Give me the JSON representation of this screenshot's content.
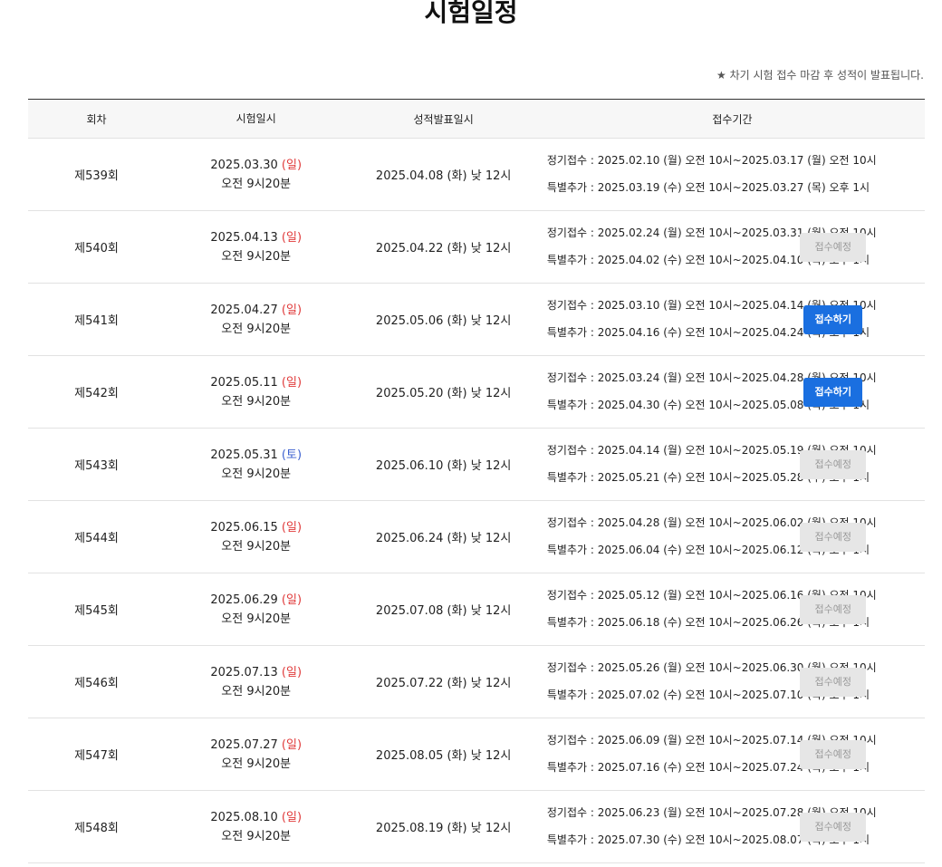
{
  "page": {
    "title": "시험일정",
    "notice": "★ 차기 시험 접수 마감 후 성적이 발표됩니다."
  },
  "table": {
    "headers": [
      "회차",
      "시험일시",
      "성적발표일시",
      "접수기간"
    ],
    "rows": [
      {
        "round": "제539회",
        "exam_date": "2025.03.30",
        "exam_dow": "(일)",
        "exam_dow_type": "sun",
        "exam_time": "오전 9시20분",
        "result_date": "2025.04.08 (화) 낮 12시",
        "regular": "정기접수 : 2025.02.10 (월) 오전 10시~2025.03.17 (월) 오전 10시",
        "special": "특별추가 : 2025.03.19 (수) 오전 10시~2025.03.27 (목) 오후 1시",
        "action": ""
      },
      {
        "round": "제540회",
        "exam_date": "2025.04.13",
        "exam_dow": "(일)",
        "exam_dow_type": "sun",
        "exam_time": "오전 9시20분",
        "result_date": "2025.04.22 (화) 낮 12시",
        "regular": "정기접수 : 2025.02.24 (월) 오전 10시~2025.03.31 (월) 오전 10시",
        "special": "특별추가 : 2025.04.02 (수) 오전 10시~2025.04.10 (목) 오후 1시",
        "action": "접수예정"
      },
      {
        "round": "제541회",
        "exam_date": "2025.04.27",
        "exam_dow": "(일)",
        "exam_dow_type": "sun",
        "exam_time": "오전 9시20분",
        "result_date": "2025.05.06 (화) 낮 12시",
        "regular": "정기접수 : 2025.03.10 (월) 오전 10시~2025.04.14 (월) 오전 10시",
        "special": "특별추가 : 2025.04.16 (수) 오전 10시~2025.04.24 (목) 오후 1시",
        "action": "접수하기"
      },
      {
        "round": "제542회",
        "exam_date": "2025.05.11",
        "exam_dow": "(일)",
        "exam_dow_type": "sun",
        "exam_time": "오전 9시20분",
        "result_date": "2025.05.20 (화) 낮 12시",
        "regular": "정기접수 : 2025.03.24 (월) 오전 10시~2025.04.28 (월) 오전 10시",
        "special": "특별추가 : 2025.04.30 (수) 오전 10시~2025.05.08 (목) 오후 1시",
        "action": "접수하기"
      },
      {
        "round": "제543회",
        "exam_date": "2025.05.31",
        "exam_dow": "(토)",
        "exam_dow_type": "sat",
        "exam_time": "오전 9시20분",
        "result_date": "2025.06.10 (화) 낮 12시",
        "regular": "정기접수 : 2025.04.14 (월) 오전 10시~2025.05.19 (월) 오전 10시",
        "special": "특별추가 : 2025.05.21 (수) 오전 10시~2025.05.28 (수) 오후 1시",
        "action": "접수예정"
      },
      {
        "round": "제544회",
        "exam_date": "2025.06.15",
        "exam_dow": "(일)",
        "exam_dow_type": "sun",
        "exam_time": "오전 9시20분",
        "result_date": "2025.06.24 (화) 낮 12시",
        "regular": "정기접수 : 2025.04.28 (월) 오전 10시~2025.06.02 (월) 오전 10시",
        "special": "특별추가 : 2025.06.04 (수) 오전 10시~2025.06.12 (목) 오후 1시",
        "action": "접수예정"
      },
      {
        "round": "제545회",
        "exam_date": "2025.06.29",
        "exam_dow": "(일)",
        "exam_dow_type": "sun",
        "exam_time": "오전 9시20분",
        "result_date": "2025.07.08 (화) 낮 12시",
        "regular": "정기접수 : 2025.05.12 (월) 오전 10시~2025.06.16 (월) 오전 10시",
        "special": "특별추가 : 2025.06.18 (수) 오전 10시~2025.06.26 (목) 오후 1시",
        "action": "접수예정"
      },
      {
        "round": "제546회",
        "exam_date": "2025.07.13",
        "exam_dow": "(일)",
        "exam_dow_type": "sun",
        "exam_time": "오전 9시20분",
        "result_date": "2025.07.22 (화) 낮 12시",
        "regular": "정기접수 : 2025.05.26 (월) 오전 10시~2025.06.30 (월) 오전 10시",
        "special": "특별추가 : 2025.07.02 (수) 오전 10시~2025.07.10 (목) 오후 1시",
        "action": "접수예정"
      },
      {
        "round": "제547회",
        "exam_date": "2025.07.27",
        "exam_dow": "(일)",
        "exam_dow_type": "sun",
        "exam_time": "오전 9시20분",
        "result_date": "2025.08.05 (화) 낮 12시",
        "regular": "정기접수 : 2025.06.09 (월) 오전 10시~2025.07.14 (월) 오전 10시",
        "special": "특별추가 : 2025.07.16 (수) 오전 10시~2025.07.24 (목) 오후 1시",
        "action": "접수예정"
      },
      {
        "round": "제548회",
        "exam_date": "2025.08.10",
        "exam_dow": "(일)",
        "exam_dow_type": "sun",
        "exam_time": "오전 9시20분",
        "result_date": "2025.08.19 (화) 낮 12시",
        "regular": "정기접수 : 2025.06.23 (월) 오전 10시~2025.07.28 (월) 오전 10시",
        "special": "특별추가 : 2025.07.30 (수) 오전 10시~2025.08.07 (목) 오후 1시",
        "action": "접수예정"
      }
    ]
  },
  "colors": {
    "sunday": "#e03a3a",
    "saturday": "#3a5fcf",
    "apply_button": "#1a6fe0",
    "pending_button": "#e6e6e6"
  }
}
